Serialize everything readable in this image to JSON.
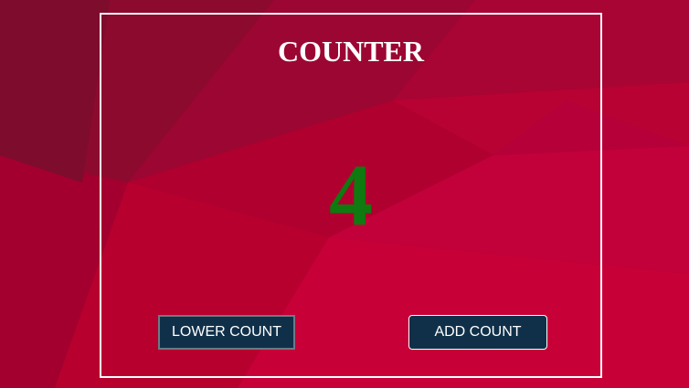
{
  "app": {
    "title": "COUNTER",
    "count": "4"
  },
  "buttons": {
    "lower_label": "LOWER COUNT",
    "add_label": "ADD COUNT"
  },
  "colors": {
    "background": "#b3002f",
    "count_text": "#0f7a0f",
    "button_bg": "#10304a",
    "border": "#ffffff"
  }
}
